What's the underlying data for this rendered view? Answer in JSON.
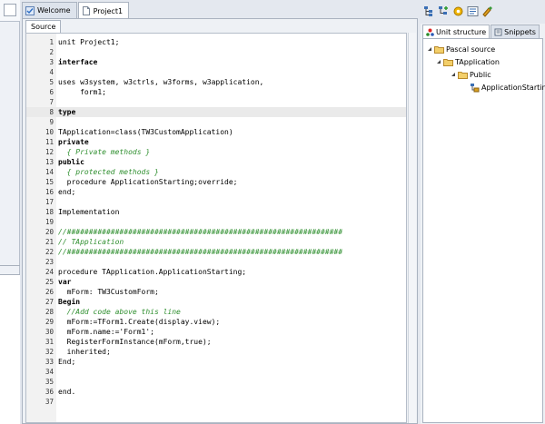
{
  "file_tabs": [
    {
      "label": "Welcome",
      "active": false
    },
    {
      "label": "Project1",
      "active": true
    }
  ],
  "editor": {
    "source_tab_label": "Source",
    "current_line": 8,
    "lines": [
      {
        "n": "1",
        "text": "unit Project1;",
        "style": ""
      },
      {
        "n": "2",
        "text": "",
        "style": ""
      },
      {
        "n": "3",
        "text": "interface",
        "style": "kw"
      },
      {
        "n": "4",
        "text": "",
        "style": ""
      },
      {
        "n": "5",
        "text": "uses w3system, w3ctrls, w3forms, w3application,",
        "style": ""
      },
      {
        "n": "6",
        "text": "     form1;",
        "style": ""
      },
      {
        "n": "7",
        "text": "",
        "style": ""
      },
      {
        "n": "8",
        "text": "type",
        "style": "kw"
      },
      {
        "n": "9",
        "text": "",
        "style": ""
      },
      {
        "n": "10",
        "text": "TApplication=class(TW3CustomApplication)",
        "style": ""
      },
      {
        "n": "11",
        "text": "private",
        "style": "kw"
      },
      {
        "n": "12",
        "text": "  { Private methods }",
        "style": "cm"
      },
      {
        "n": "13",
        "text": "public",
        "style": "kw"
      },
      {
        "n": "14",
        "text": "  { protected methods }",
        "style": "cm"
      },
      {
        "n": "15",
        "text": "  procedure ApplicationStarting;override;",
        "style": ""
      },
      {
        "n": "16",
        "text": "end;",
        "style": ""
      },
      {
        "n": "17",
        "text": "",
        "style": ""
      },
      {
        "n": "18",
        "text": "Implementation",
        "style": ""
      },
      {
        "n": "19",
        "text": "",
        "style": ""
      },
      {
        "n": "20",
        "text": "//###############################################################",
        "style": "cm"
      },
      {
        "n": "21",
        "text": "// TApplication",
        "style": "cm"
      },
      {
        "n": "22",
        "text": "//###############################################################",
        "style": "cm"
      },
      {
        "n": "23",
        "text": "",
        "style": ""
      },
      {
        "n": "24",
        "text": "procedure TApplication.ApplicationStarting;",
        "style": ""
      },
      {
        "n": "25",
        "text": "var",
        "style": "kw"
      },
      {
        "n": "26",
        "text": "  mForm: TW3CustomForm;",
        "style": ""
      },
      {
        "n": "27",
        "text": "Begin",
        "style": "kw"
      },
      {
        "n": "28",
        "text": "  //Add code above this line",
        "style": "cm"
      },
      {
        "n": "29",
        "text": "  mForm:=TForm1.Create(display.view);",
        "style": ""
      },
      {
        "n": "30",
        "text": "  mForm.name:='Form1';",
        "style": ""
      },
      {
        "n": "31",
        "text": "  RegisterFormInstance(mForm,true);",
        "style": ""
      },
      {
        "n": "32",
        "text": "  inherited;",
        "style": ""
      },
      {
        "n": "33",
        "text": "End;",
        "style": ""
      },
      {
        "n": "34",
        "text": "",
        "style": ""
      },
      {
        "n": "35",
        "text": "",
        "style": ""
      },
      {
        "n": "36",
        "text": "end.",
        "style": ""
      },
      {
        "n": "37",
        "text": "",
        "style": ""
      }
    ]
  },
  "right_panel": {
    "tabs": [
      {
        "label": "Unit structure",
        "active": true,
        "icon": "structure-icon"
      },
      {
        "label": "Snippets",
        "active": false,
        "icon": "snippets-icon"
      }
    ],
    "tree": [
      {
        "label": "Pascal source",
        "icon": "folder-icon",
        "expanded": true
      },
      {
        "label": "TApplication",
        "icon": "folder-icon",
        "expanded": true
      },
      {
        "label": "Public",
        "icon": "folder-icon",
        "expanded": true
      },
      {
        "label": "ApplicationStarting",
        "icon": "method-icon",
        "expanded": false
      }
    ]
  },
  "toolbar": {
    "buttons": [
      "add-class-icon",
      "add-member-icon",
      "settings-icon",
      "list-icon",
      "paint-icon"
    ]
  },
  "colors": {
    "comment": "#2f8f2f",
    "current_line": "#eaeaea",
    "folder": "#e7b94a",
    "accent": "#4a7fc1"
  }
}
